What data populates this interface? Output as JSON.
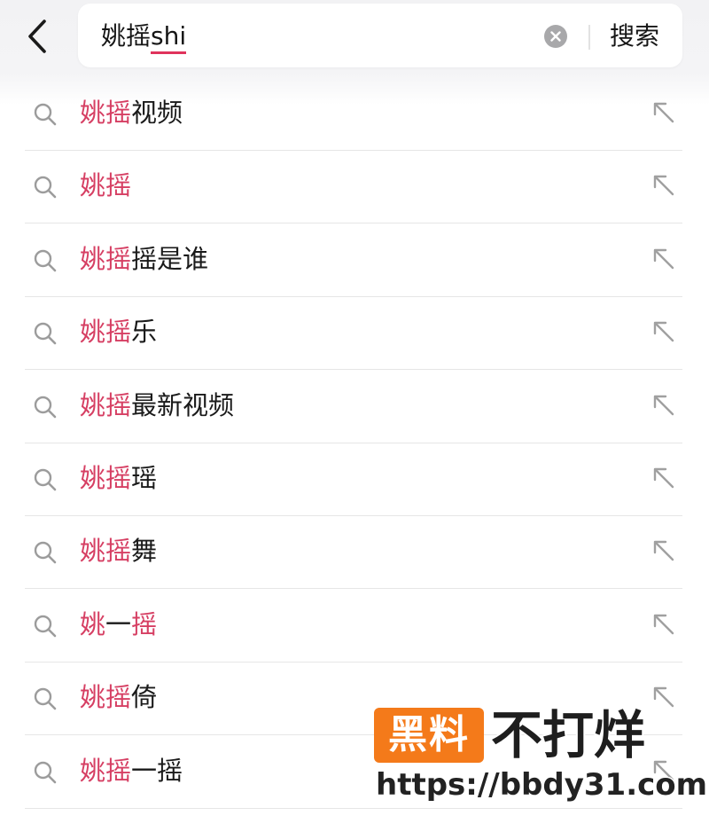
{
  "search": {
    "query_chinese": "姚摇",
    "query_pinyin": "shi",
    "search_button_label": "搜索"
  },
  "icons": {
    "back": "chevron-left-icon",
    "clear": "clear-circle-icon",
    "suggestion": "search-icon",
    "fill": "arrow-up-left-icon"
  },
  "colors": {
    "highlight": "#d63f63",
    "watermark_badge": "#f47a1a"
  },
  "suggestions": [
    {
      "highlight": "姚摇",
      "rest": "视频"
    },
    {
      "highlight": "姚摇",
      "rest": ""
    },
    {
      "highlight": "姚摇",
      "rest": "摇是谁"
    },
    {
      "highlight": "姚摇",
      "rest": "乐"
    },
    {
      "highlight": "姚摇",
      "rest": "最新视频"
    },
    {
      "highlight": "姚摇",
      "rest": "瑶"
    },
    {
      "highlight": "姚摇",
      "rest": "舞"
    },
    {
      "highlight": "姚",
      "rest": "一",
      "highlight2": "摇"
    },
    {
      "highlight": "姚摇",
      "rest": "倚"
    },
    {
      "highlight": "姚摇",
      "rest": "一摇"
    }
  ],
  "watermark": {
    "badge": "黑料",
    "name": "不打烊",
    "url": "https://bbdy31.com"
  }
}
